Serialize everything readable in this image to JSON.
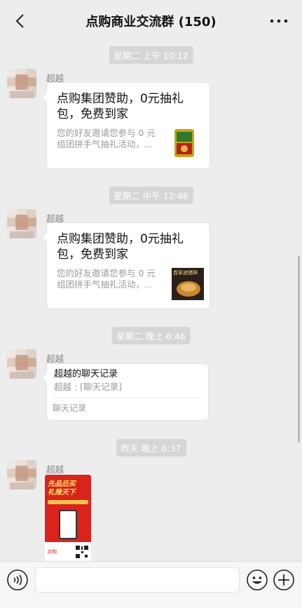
{
  "header": {
    "title": "点购商业交流群 (150)"
  },
  "messages": [
    {
      "time": "星期二 上午 10:12",
      "sender": "超越",
      "card_title": "点购集团赞助，0元抽礼包，免费到家",
      "card_desc": "您的好友邀请您参与 0 元组团拼手气抽礼活动，...",
      "thumb_icon": "red-spicy-snack-package"
    },
    {
      "time": "星期二 中午 12:46",
      "sender": "超越",
      "card_title": "点购集团赞助，0元抽礼包，免费到家",
      "card_desc": "您的好友邀请您参与 0 元组团拼手气抽礼活动，...",
      "thumb_text": "首家卤猪蹄"
    },
    {
      "time": "星期二 晚上 6:46",
      "sender": "超越",
      "record_title": "超越的聊天记录",
      "record_sub": "超越 : [聊天记录]",
      "record_foot": "聊天记录"
    },
    {
      "time": "昨天 晚上 6:37",
      "sender": "超越",
      "poster": {
        "headline_1": "先品后买",
        "headline_2": "礼推天下",
        "brand": "点购"
      }
    }
  ],
  "colors": {
    "background": "#ededed",
    "bubble": "#ffffff",
    "poster_red": "#d8241c",
    "timestamp": "#d6d6d6"
  }
}
